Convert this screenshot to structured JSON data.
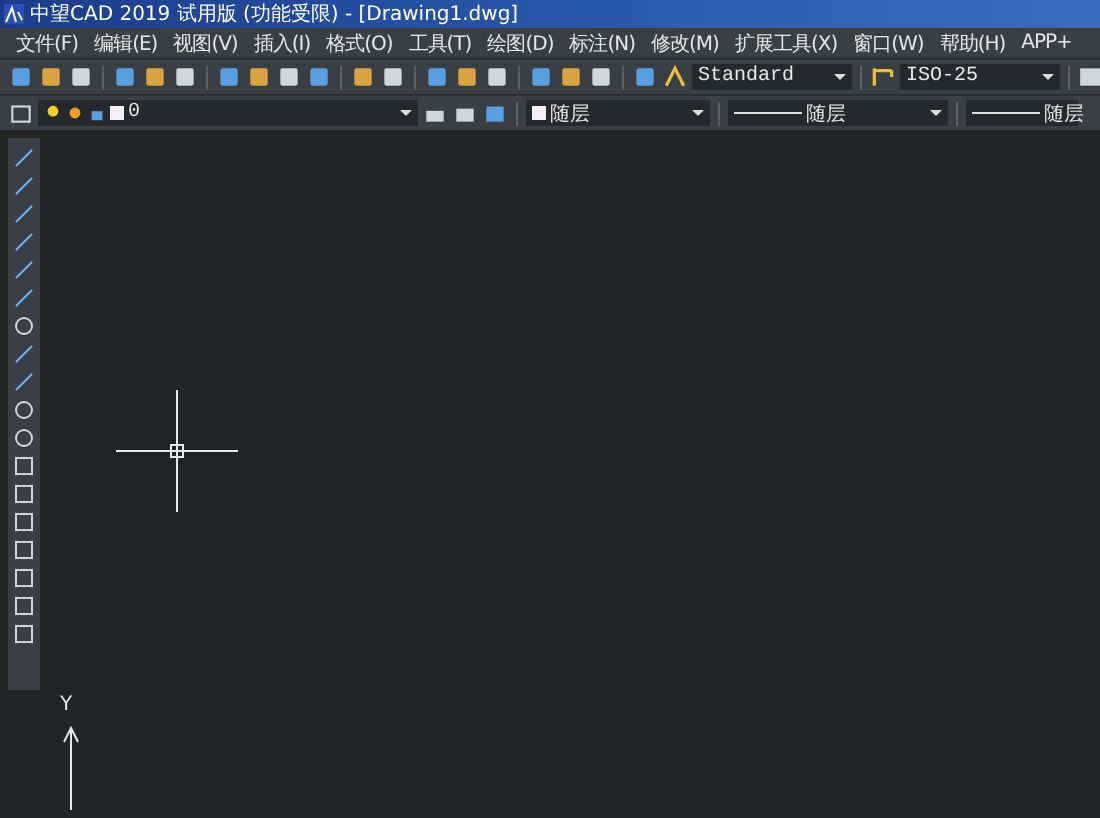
{
  "window": {
    "title": "中望CAD 2019 试用版 (功能受限) - [Drawing1.dwg]"
  },
  "menu": [
    "文件(F)",
    "编辑(E)",
    "视图(V)",
    "插入(I)",
    "格式(O)",
    "工具(T)",
    "绘图(D)",
    "标注(N)",
    "修改(M)",
    "扩展工具(X)",
    "窗口(W)",
    "帮助(H)",
    "APP+"
  ],
  "toolbar": {
    "text_style": "Standard",
    "dim_style": "ISO-25"
  },
  "layer_bar": {
    "layer": "0",
    "color_setting": "随层",
    "linetype": "随层",
    "lineweight": "随层"
  },
  "canvas": {
    "axis_label": "Y"
  }
}
